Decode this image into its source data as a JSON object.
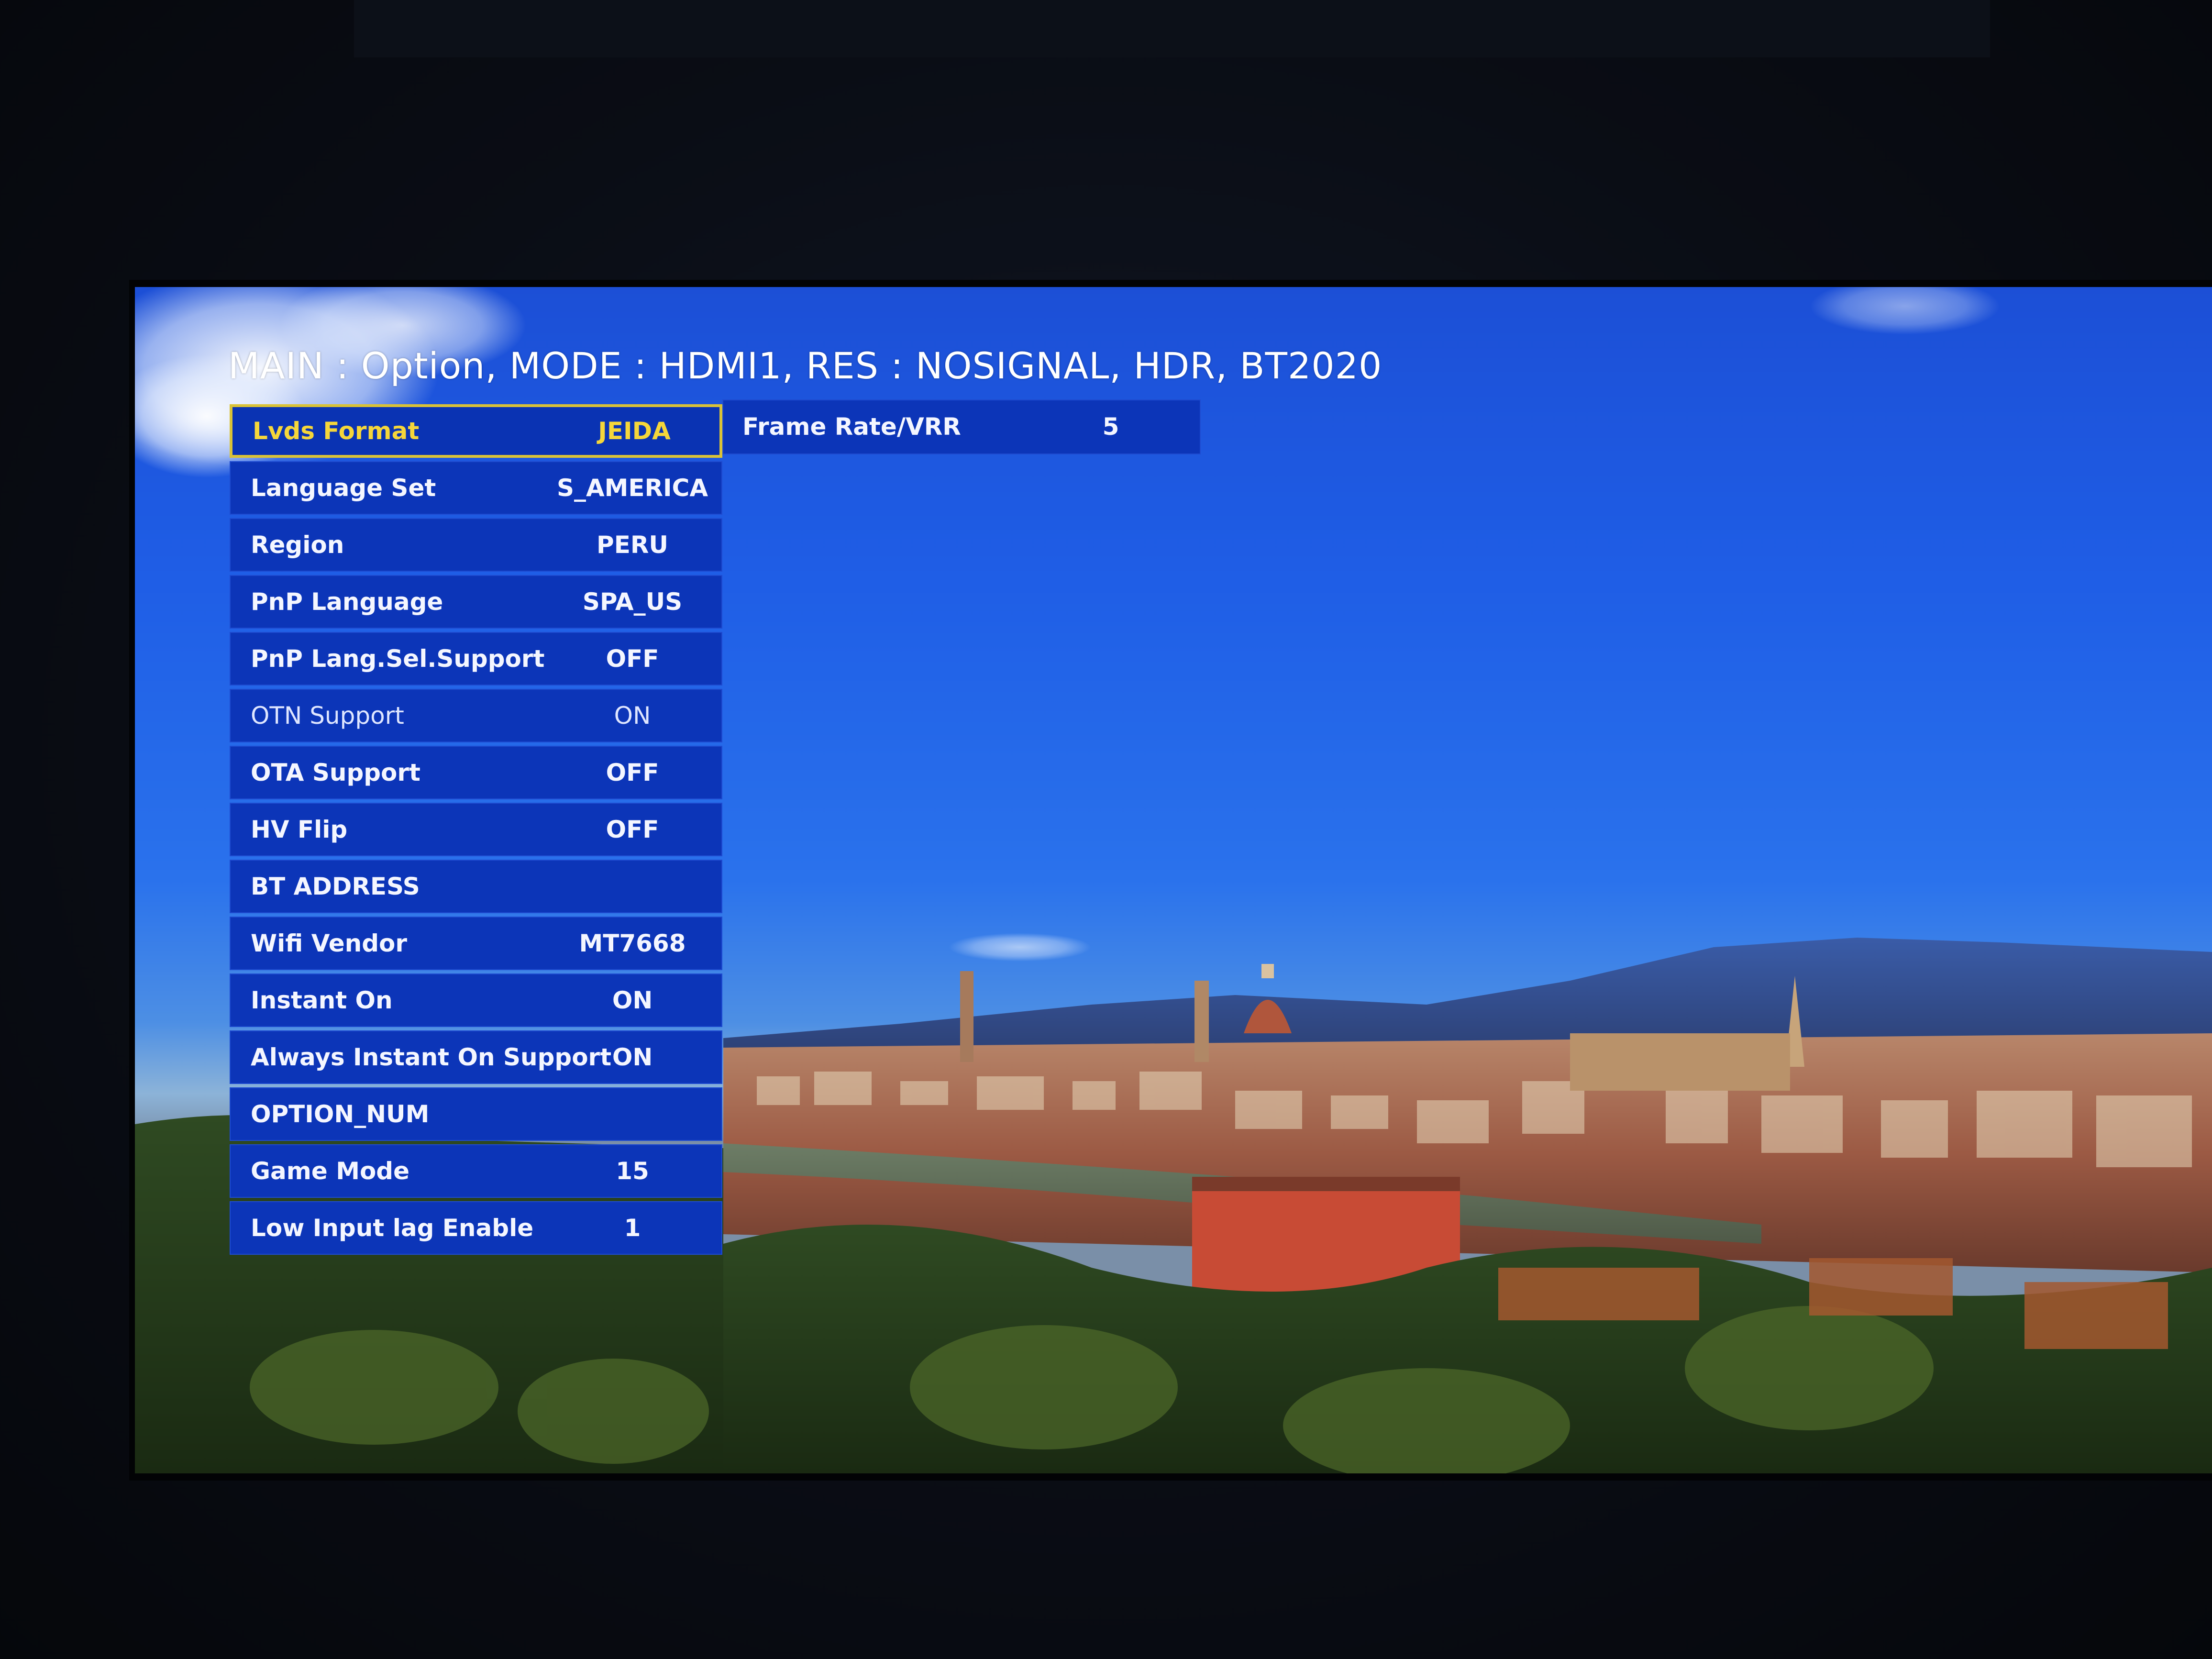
{
  "osd": {
    "title": "MAIN : Option, MODE : HDMI1, RES : NOSIGNAL, HDR, BT2020"
  },
  "menu": {
    "items": [
      {
        "label": "Lvds Format",
        "value": "JEIDA"
      },
      {
        "label": "Language Set",
        "value": "S_AMERICA"
      },
      {
        "label": "Region",
        "value": "PERU"
      },
      {
        "label": "PnP Language",
        "value": "SPA_US"
      },
      {
        "label": "PnP Lang.Sel.Support",
        "value": "OFF"
      },
      {
        "label": "OTN Support",
        "value": "ON"
      },
      {
        "label": "OTA Support",
        "value": "OFF"
      },
      {
        "label": "HV Flip",
        "value": "OFF"
      },
      {
        "label": "BT ADDRESS",
        "value": ""
      },
      {
        "label": "Wifi Vendor",
        "value": "MT7668"
      },
      {
        "label": "Instant On",
        "value": "ON"
      },
      {
        "label": "Always Instant On Support",
        "value": "ON"
      },
      {
        "label": "OPTION_NUM",
        "value": ""
      },
      {
        "label": "Game Mode",
        "value": "15"
      },
      {
        "label": "Low Input lag Enable",
        "value": "1"
      }
    ],
    "selected_index": 0
  },
  "submenu": {
    "label": "Frame Rate/VRR",
    "value": "5"
  },
  "colors": {
    "row_bg": "#0c35b8",
    "selected_border": "#d9c237",
    "selected_text": "#f5d63a",
    "text": "#f4f6ff",
    "sky": "#1f5ee6"
  }
}
